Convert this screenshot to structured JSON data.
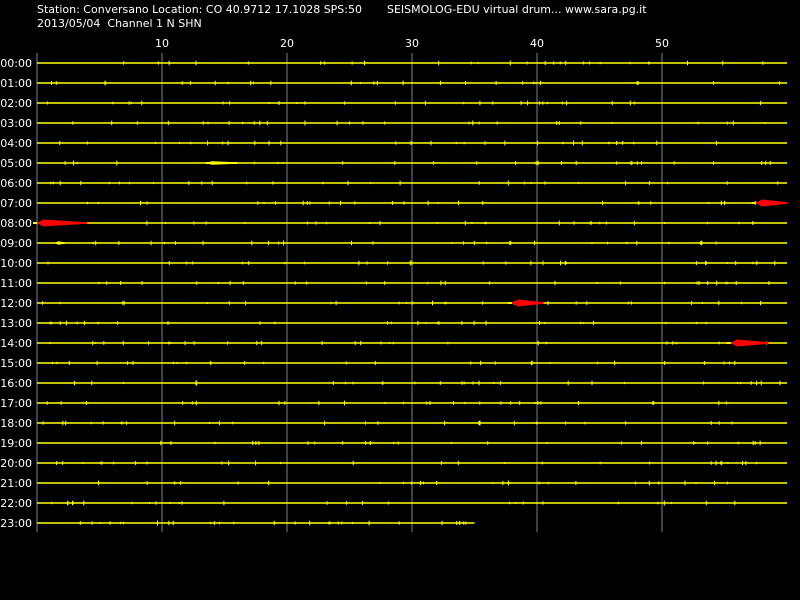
{
  "header": {
    "station_line": "Station: Conversano Location: CO 40.9712 17.1028 SPS:50",
    "date_line": "2013/05/04  Channel 1 N SHN",
    "software_line": "SEISMOLOG-EDU virtual drum... www.sara.pg.it"
  },
  "colors": {
    "background": "#000000",
    "trace": "#ffff00",
    "event": "#ff0000",
    "grid": "#808080",
    "text": "#ffffff"
  },
  "chart_data": {
    "type": "line",
    "xlabel": "",
    "ylabel": "",
    "xlim": [
      0,
      60
    ],
    "x_ticks": [
      10,
      20,
      30,
      40,
      50
    ],
    "rows": [
      "00:00",
      "01:00",
      "02:00",
      "03:00",
      "04:00",
      "05:00",
      "06:00",
      "07:00",
      "08:00",
      "09:00",
      "10:00",
      "11:00",
      "12:00",
      "13:00",
      "14:00",
      "15:00",
      "16:00",
      "17:00",
      "18:00",
      "19:00",
      "20:00",
      "21:00",
      "22:00",
      "23:00"
    ],
    "trace_end_minute": {
      "23:00": 35
    },
    "events": [
      {
        "row": "05:00",
        "start": 13.5,
        "end": 16,
        "color": "yellow"
      },
      {
        "row": "07:00",
        "start": 57.5,
        "end": 60,
        "color": "red"
      },
      {
        "row": "08:00",
        "start": 0,
        "end": 4,
        "color": "red"
      },
      {
        "row": "09:00",
        "start": 1.5,
        "end": 2.2,
        "color": "yellow"
      },
      {
        "row": "12:00",
        "start": 38,
        "end": 40.5,
        "color": "red"
      },
      {
        "row": "14:00",
        "start": 55.5,
        "end": 58.5,
        "color": "red"
      }
    ],
    "grid": true
  }
}
